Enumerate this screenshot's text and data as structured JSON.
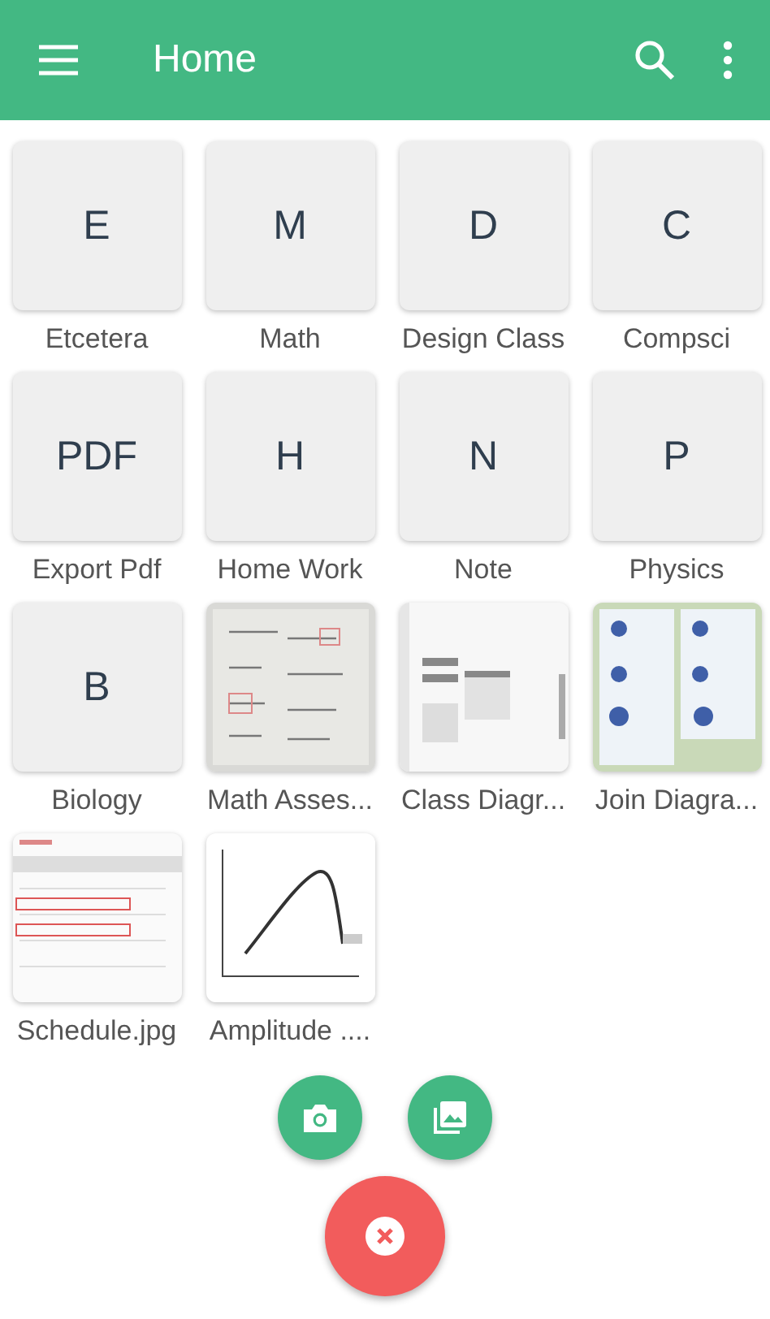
{
  "app_bar": {
    "title": "Home"
  },
  "items": [
    {
      "kind": "letter",
      "letter": "E",
      "label": "Etcetera"
    },
    {
      "kind": "letter",
      "letter": "M",
      "label": "Math"
    },
    {
      "kind": "letter",
      "letter": "D",
      "label": "Design Class"
    },
    {
      "kind": "letter",
      "letter": "C",
      "label": "Compsci"
    },
    {
      "kind": "letter",
      "letter": "PDF",
      "label": "Export Pdf"
    },
    {
      "kind": "letter",
      "letter": "H",
      "label": "Home Work"
    },
    {
      "kind": "letter",
      "letter": "N",
      "label": "Note"
    },
    {
      "kind": "letter",
      "letter": "P",
      "label": "Physics"
    },
    {
      "kind": "letter",
      "letter": "B",
      "label": "Biology"
    },
    {
      "kind": "picture",
      "label": "Math Asses..."
    },
    {
      "kind": "picture",
      "label": "Class Diagr..."
    },
    {
      "kind": "picture",
      "label": "Join Diagra..."
    },
    {
      "kind": "picture",
      "label": "Schedule.jpg"
    },
    {
      "kind": "picture",
      "label": "Amplitude ...."
    }
  ]
}
